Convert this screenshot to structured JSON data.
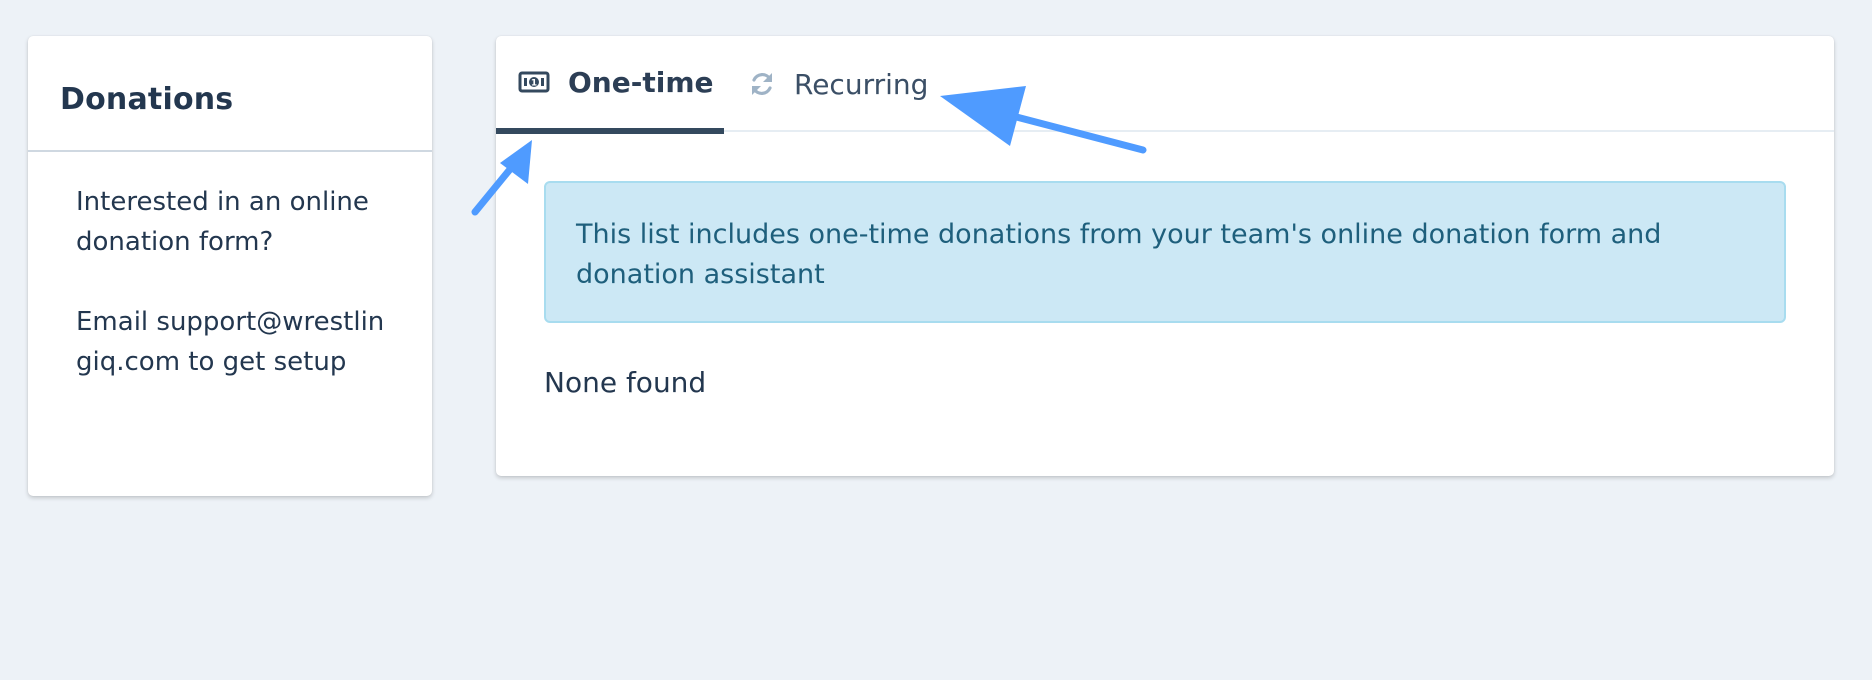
{
  "sidebar_card": {
    "title": "Donations",
    "message_line1": "Interested in an online donation form?",
    "message_line2": "Email support@wrestlingiq.com to get setup"
  },
  "tabs": [
    {
      "label": "One-time",
      "icon": "money-bill-icon",
      "active": true
    },
    {
      "label": "Recurring",
      "icon": "sync-icon",
      "active": false
    }
  ],
  "main": {
    "info_alert": "This list includes one-time donations from your team's online donation form and donation assistant",
    "empty_state": "None found"
  },
  "colors": {
    "background": "#edf2f7",
    "active_tab_underline": "#34495e",
    "alert_background": "#cce8f5",
    "alert_text": "#1e5f7c",
    "annotation_arrow": "#4f9bff"
  }
}
